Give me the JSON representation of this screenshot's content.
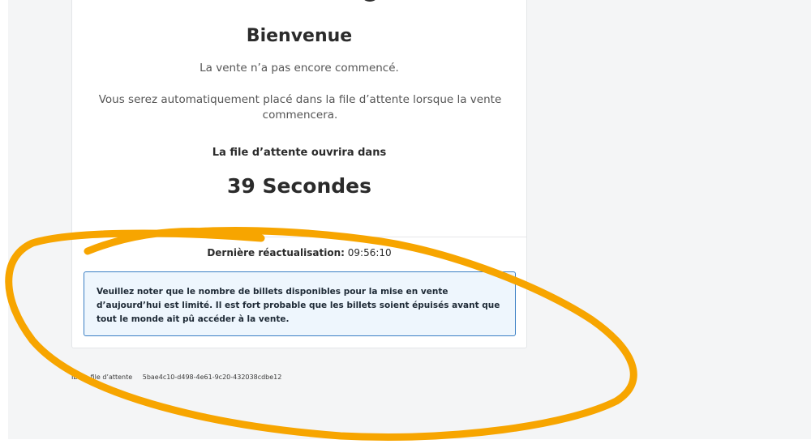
{
  "card": {
    "title": "Bienvenue",
    "subtitle": "La vente n’a pas encore commencé.",
    "info": "Vous serez automatiquement placé dans la file d’attente lorsque la vente commencera.",
    "queue_open_label": "La file d’attente ouvrira dans",
    "countdown": "39 Secondes",
    "last_refresh_label": "Dernière réactualisation:",
    "last_refresh_time": "09:56:10",
    "notice": "Veuillez noter que le nombre de billets disponibles pour la mise en vente d’aujourd’hui est limité. Il est fort probable que les billets soient épuisés avant que tout le monde ait pû accéder à la vente."
  },
  "footer": {
    "queue_id_label": "ID de file d’attente",
    "queue_id_value": "5bae4c10-d498-4e61-9c20-432038cdbe12"
  },
  "colors": {
    "annotation": "#f7a500",
    "notice_border": "#3a7fc4",
    "notice_bg": "#eef6fd",
    "page_bg": "#f4f5f6"
  }
}
